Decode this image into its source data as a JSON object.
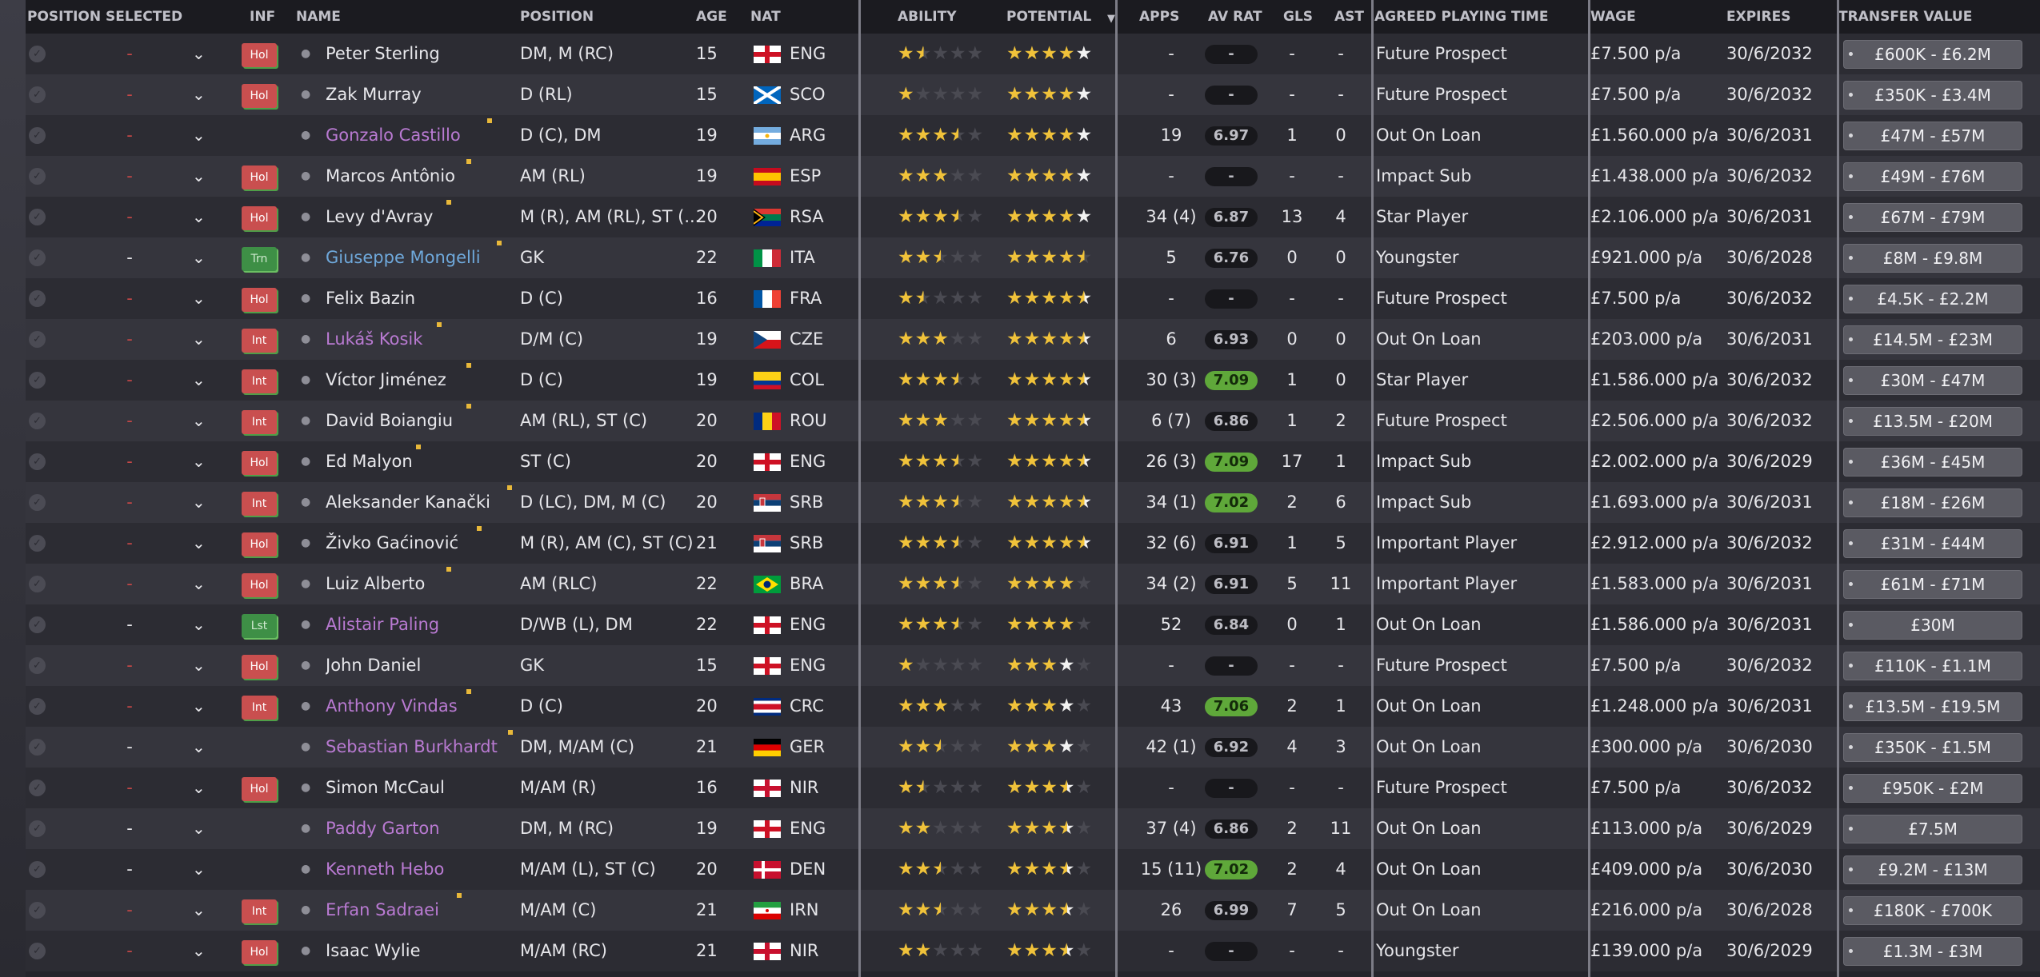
{
  "headers": {
    "position_selected": "POSITION SELECTED",
    "inf": "INF",
    "name": "NAME",
    "position": "POSITION",
    "age": "AGE",
    "nat": "NAT",
    "ability": "ABILITY",
    "potential": "POTENTIAL",
    "apps": "APPS",
    "av_rat": "AV RAT",
    "gls": "GLS",
    "ast": "AST",
    "agreed_playing_time": "AGREED PLAYING TIME",
    "wage": "WAGE",
    "expires": "EXPIRES",
    "transfer_value": "TRANSFER VALUE",
    "sort_icon": "sort-descending-icon"
  },
  "colors": {
    "accent_yellow_star": "#f0c23a",
    "badge_red": "#c94f4f",
    "badge_green": "#3e8f46",
    "rating_good": "#5fa83a",
    "name_purple": "#b97ad2",
    "name_blue": "#6fa9dc"
  },
  "players": [
    {
      "pos_sel": "-",
      "pos_sel_red": true,
      "inf": "Hol",
      "name": "Peter Sterling",
      "name_color": "white",
      "dot": false,
      "position": "DM, M (RC)",
      "age": "15",
      "flag": "eng",
      "nat": "ENG",
      "ability": 1.5,
      "potential": "4w",
      "apps": "-",
      "avrat": "-",
      "avgood": false,
      "gls": "-",
      "ast": "-",
      "apt": "Future Prospect",
      "wage": "£7.500 p/a",
      "expires": "30/6/2032",
      "tv": "£600K - £6.2M"
    },
    {
      "pos_sel": "-",
      "pos_sel_red": true,
      "inf": "Hol",
      "name": "Zak Murray",
      "name_color": "white",
      "dot": false,
      "position": "D (RL)",
      "age": "15",
      "flag": "sco",
      "nat": "SCO",
      "ability": 1,
      "potential": "4w",
      "apps": "-",
      "avrat": "-",
      "avgood": false,
      "gls": "-",
      "ast": "-",
      "apt": "Future Prospect",
      "wage": "£7.500 p/a",
      "expires": "30/6/2032",
      "tv": "£350K - £3.4M"
    },
    {
      "pos_sel": "-",
      "pos_sel_red": true,
      "inf": "",
      "name": "Gonzalo Castillo",
      "name_color": "purple",
      "dot": true,
      "position": "D (C), DM",
      "age": "19",
      "flag": "arg",
      "nat": "ARG",
      "ability": 3.5,
      "potential": "4w",
      "apps": "19",
      "avrat": "6.97",
      "avgood": false,
      "gls": "1",
      "ast": "0",
      "apt": "Out On Loan",
      "wage": "£1.560.000 p/a",
      "expires": "30/6/2031",
      "tv": "£47M - £57M"
    },
    {
      "pos_sel": "-",
      "pos_sel_red": true,
      "inf": "Hol",
      "name": "Marcos Antônio",
      "name_color": "white",
      "dot": true,
      "position": "AM (RL)",
      "age": "19",
      "flag": "esp",
      "nat": "ESP",
      "ability": 3,
      "potential": "4w",
      "apps": "-",
      "avrat": "-",
      "avgood": false,
      "gls": "-",
      "ast": "-",
      "apt": "Impact Sub",
      "wage": "£1.438.000 p/a",
      "expires": "30/6/2032",
      "tv": "£49M - £76M"
    },
    {
      "pos_sel": "-",
      "pos_sel_red": true,
      "inf": "Hol",
      "name": "Levy d'Avray",
      "name_color": "white",
      "dot": true,
      "position": "M (R), AM (RL), ST (...",
      "age": "20",
      "flag": "rsa",
      "nat": "RSA",
      "ability": 3.5,
      "potential": "4w",
      "apps": "34 (4)",
      "avrat": "6.87",
      "avgood": false,
      "gls": "13",
      "ast": "4",
      "apt": "Star Player",
      "wage": "£2.106.000 p/a",
      "expires": "30/6/2031",
      "tv": "£67M - £79M"
    },
    {
      "pos_sel": "-",
      "pos_sel_red": false,
      "inf": "Trn",
      "name": "Giuseppe Mongelli",
      "name_color": "blue",
      "dot": true,
      "position": "GK",
      "age": "22",
      "flag": "ita",
      "nat": "ITA",
      "ability": 2.5,
      "potential": "4.5",
      "apps": "5",
      "avrat": "6.76",
      "avgood": false,
      "gls": "0",
      "ast": "0",
      "apt": "Youngster",
      "wage": "£921.000 p/a",
      "expires": "30/6/2028",
      "tv": "£8M - £9.8M"
    },
    {
      "pos_sel": "-",
      "pos_sel_red": true,
      "inf": "Hol",
      "name": "Felix Bazin",
      "name_color": "white",
      "dot": false,
      "position": "D (C)",
      "age": "16",
      "flag": "fra",
      "nat": "FRA",
      "ability": 1.5,
      "potential": "4hw",
      "apps": "-",
      "avrat": "-",
      "avgood": false,
      "gls": "-",
      "ast": "-",
      "apt": "Future Prospect",
      "wage": "£7.500 p/a",
      "expires": "30/6/2032",
      "tv": "£4.5K - £2.2M"
    },
    {
      "pos_sel": "-",
      "pos_sel_red": true,
      "inf": "Int",
      "name": "Lukáš Kosik",
      "name_color": "purple",
      "dot": true,
      "position": "D/M (C)",
      "age": "19",
      "flag": "cze",
      "nat": "CZE",
      "ability": 3,
      "potential": "4hw",
      "apps": "6",
      "avrat": "6.93",
      "avgood": false,
      "gls": "0",
      "ast": "0",
      "apt": "Out On Loan",
      "wage": "£203.000 p/a",
      "expires": "30/6/2031",
      "tv": "£14.5M - £23M"
    },
    {
      "pos_sel": "-",
      "pos_sel_red": true,
      "inf": "Int",
      "name": "Víctor Jiménez",
      "name_color": "white",
      "dot": true,
      "position": "D (C)",
      "age": "19",
      "flag": "col",
      "nat": "COL",
      "ability": 3.5,
      "potential": "4hw",
      "apps": "30 (3)",
      "avrat": "7.09",
      "avgood": true,
      "gls": "1",
      "ast": "0",
      "apt": "Star Player",
      "wage": "£1.586.000 p/a",
      "expires": "30/6/2032",
      "tv": "£30M - £47M"
    },
    {
      "pos_sel": "-",
      "pos_sel_red": true,
      "inf": "Int",
      "name": "David Boiangiu",
      "name_color": "white",
      "dot": true,
      "position": "AM (RL), ST (C)",
      "age": "20",
      "flag": "rou",
      "nat": "ROU",
      "ability": 3,
      "potential": "4hw",
      "apps": "6 (7)",
      "avrat": "6.86",
      "avgood": false,
      "gls": "1",
      "ast": "2",
      "apt": "Future Prospect",
      "wage": "£2.506.000 p/a",
      "expires": "30/6/2032",
      "tv": "£13.5M - £20M"
    },
    {
      "pos_sel": "-",
      "pos_sel_red": true,
      "inf": "Hol",
      "name": "Ed Malyon",
      "name_color": "white",
      "dot": true,
      "position": "ST (C)",
      "age": "20",
      "flag": "eng",
      "nat": "ENG",
      "ability": 3.5,
      "potential": "4hw",
      "apps": "26 (3)",
      "avrat": "7.09",
      "avgood": true,
      "gls": "17",
      "ast": "1",
      "apt": "Impact Sub",
      "wage": "£2.002.000 p/a",
      "expires": "30/6/2029",
      "tv": "£36M - £45M"
    },
    {
      "pos_sel": "-",
      "pos_sel_red": true,
      "inf": "Int",
      "name": "Aleksander Kanački",
      "name_color": "white",
      "dot": true,
      "position": "D (LC), DM, M (C)",
      "age": "20",
      "flag": "srb",
      "nat": "SRB",
      "ability": 3.5,
      "potential": "4hw",
      "apps": "34 (1)",
      "avrat": "7.02",
      "avgood": true,
      "gls": "2",
      "ast": "6",
      "apt": "Impact Sub",
      "wage": "£1.693.000 p/a",
      "expires": "30/6/2031",
      "tv": "£18M - £26M"
    },
    {
      "pos_sel": "-",
      "pos_sel_red": true,
      "inf": "Hol",
      "name": "Živko Gaćinović",
      "name_color": "white",
      "dot": true,
      "position": "M (R), AM (C), ST (C)",
      "age": "21",
      "flag": "srb",
      "nat": "SRB",
      "ability": 3.5,
      "potential": "4hw",
      "apps": "32 (6)",
      "avrat": "6.91",
      "avgood": false,
      "gls": "1",
      "ast": "5",
      "apt": "Important Player",
      "wage": "£2.912.000 p/a",
      "expires": "30/6/2032",
      "tv": "£31M - £44M"
    },
    {
      "pos_sel": "-",
      "pos_sel_red": true,
      "inf": "Hol",
      "name": "Luiz Alberto",
      "name_color": "white",
      "dot": true,
      "position": "AM (RLC)",
      "age": "22",
      "flag": "bra",
      "nat": "BRA",
      "ability": 3.5,
      "potential": "4",
      "apps": "34 (2)",
      "avrat": "6.91",
      "avgood": false,
      "gls": "5",
      "ast": "11",
      "apt": "Important Player",
      "wage": "£1.583.000 p/a",
      "expires": "30/6/2031",
      "tv": "£61M - £71M"
    },
    {
      "pos_sel": "-",
      "pos_sel_red": false,
      "inf": "Lst",
      "name": "Alistair Paling",
      "name_color": "purple",
      "dot": false,
      "position": "D/WB (L), DM",
      "age": "22",
      "flag": "eng",
      "nat": "ENG",
      "ability": 3.5,
      "potential": "4",
      "apps": "52",
      "avrat": "6.84",
      "avgood": false,
      "gls": "0",
      "ast": "1",
      "apt": "Out On Loan",
      "wage": "£1.586.000 p/a",
      "expires": "30/6/2031",
      "tv": "£30M"
    },
    {
      "pos_sel": "-",
      "pos_sel_red": true,
      "inf": "Hol",
      "name": "John Daniel",
      "name_color": "white",
      "dot": false,
      "position": "GK",
      "age": "15",
      "flag": "eng",
      "nat": "ENG",
      "ability": 1,
      "potential": "3w",
      "apps": "-",
      "avrat": "-",
      "avgood": false,
      "gls": "-",
      "ast": "-",
      "apt": "Future Prospect",
      "wage": "£7.500 p/a",
      "expires": "30/6/2032",
      "tv": "£110K - £1.1M"
    },
    {
      "pos_sel": "-",
      "pos_sel_red": true,
      "inf": "Int",
      "name": "Anthony Vindas",
      "name_color": "purple",
      "dot": true,
      "position": "D (C)",
      "age": "20",
      "flag": "crc",
      "nat": "CRC",
      "ability": 3,
      "potential": "3w",
      "apps": "43",
      "avrat": "7.06",
      "avgood": true,
      "gls": "2",
      "ast": "1",
      "apt": "Out On Loan",
      "wage": "£1.248.000 p/a",
      "expires": "30/6/2031",
      "tv": "£13.5M - £19.5M"
    },
    {
      "pos_sel": "-",
      "pos_sel_red": false,
      "inf": "",
      "name": "Sebastian Burkhardt",
      "name_color": "purple",
      "dot": true,
      "position": "DM, M/AM (C)",
      "age": "21",
      "flag": "ger",
      "nat": "GER",
      "ability": 2.5,
      "potential": "3w",
      "apps": "42 (1)",
      "avrat": "6.92",
      "avgood": false,
      "gls": "4",
      "ast": "3",
      "apt": "Out On Loan",
      "wage": "£300.000 p/a",
      "expires": "30/6/2030",
      "tv": "£350K - £1.5M"
    },
    {
      "pos_sel": "-",
      "pos_sel_red": true,
      "inf": "Hol",
      "name": "Simon McCaul",
      "name_color": "white",
      "dot": false,
      "position": "M/AM (R)",
      "age": "16",
      "flag": "nir",
      "nat": "NIR",
      "ability": 1.5,
      "potential": "2hw",
      "apps": "-",
      "avrat": "-",
      "avgood": false,
      "gls": "-",
      "ast": "-",
      "apt": "Future Prospect",
      "wage": "£7.500 p/a",
      "expires": "30/6/2032",
      "tv": "£950K - £2M"
    },
    {
      "pos_sel": "-",
      "pos_sel_red": false,
      "inf": "",
      "name": "Paddy Garton",
      "name_color": "purple",
      "dot": false,
      "position": "DM, M (RC)",
      "age": "19",
      "flag": "eng",
      "nat": "ENG",
      "ability": 2,
      "potential": "2hw",
      "apps": "37 (4)",
      "avrat": "6.86",
      "avgood": false,
      "gls": "2",
      "ast": "11",
      "apt": "Out On Loan",
      "wage": "£113.000 p/a",
      "expires": "30/6/2029",
      "tv": "£7.5M"
    },
    {
      "pos_sel": "-",
      "pos_sel_red": false,
      "inf": "",
      "name": "Kenneth Hebo",
      "name_color": "purple",
      "dot": false,
      "position": "M/AM (L), ST (C)",
      "age": "20",
      "flag": "den",
      "nat": "DEN",
      "ability": 2.5,
      "potential": "2hw",
      "apps": "15 (11)",
      "avrat": "7.02",
      "avgood": true,
      "gls": "2",
      "ast": "4",
      "apt": "Out On Loan",
      "wage": "£409.000 p/a",
      "expires": "30/6/2030",
      "tv": "£9.2M - £13M"
    },
    {
      "pos_sel": "-",
      "pos_sel_red": true,
      "inf": "Int",
      "name": "Erfan Sadraei",
      "name_color": "purple",
      "dot": true,
      "position": "M/AM (C)",
      "age": "21",
      "flag": "irn",
      "nat": "IRN",
      "ability": 2.5,
      "potential": "2hw",
      "apps": "26",
      "avrat": "6.99",
      "avgood": false,
      "gls": "7",
      "ast": "5",
      "apt": "Out On Loan",
      "wage": "£216.000 p/a",
      "expires": "30/6/2028",
      "tv": "£180K - £700K"
    },
    {
      "pos_sel": "-",
      "pos_sel_red": true,
      "inf": "Hol",
      "name": "Isaac Wylie",
      "name_color": "white",
      "dot": false,
      "position": "M/AM (RC)",
      "age": "21",
      "flag": "nir",
      "nat": "NIR",
      "ability": 2,
      "potential": "2hw",
      "apps": "-",
      "avrat": "-",
      "avgood": false,
      "gls": "-",
      "ast": "-",
      "apt": "Youngster",
      "wage": "£139.000 p/a",
      "expires": "30/6/2029",
      "tv": "£1.3M - £3M"
    }
  ]
}
